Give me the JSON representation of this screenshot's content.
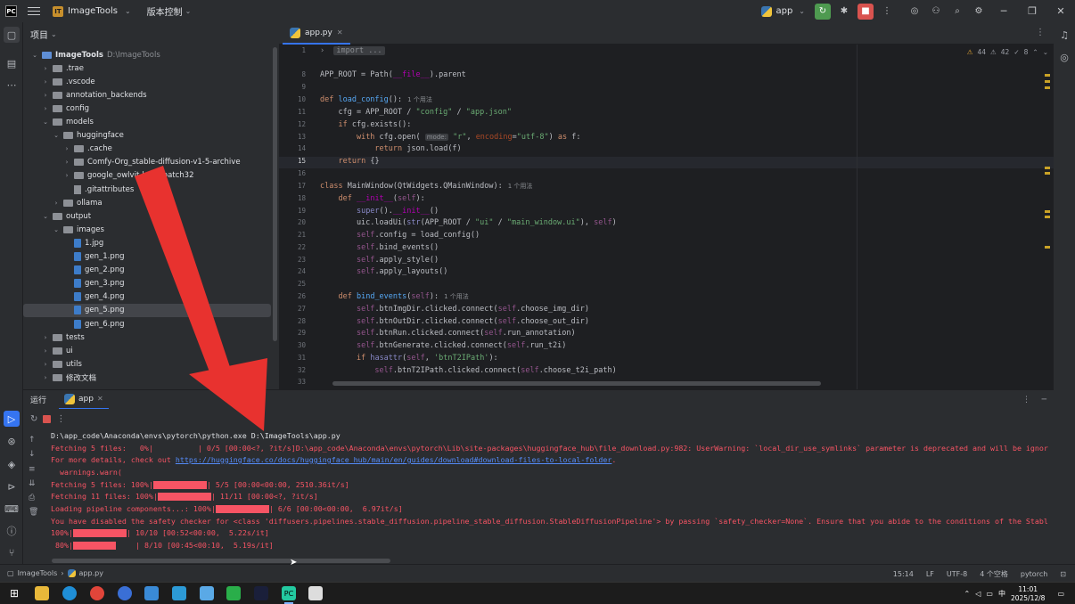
{
  "titlebar": {
    "project_name": "ImageTools",
    "vcs_label": "版本控制",
    "run_config": "app",
    "win_minimize": "─",
    "win_maximize": "❐",
    "win_close": "✕"
  },
  "project_panel": {
    "title": "项目",
    "tree": [
      {
        "label": "ImageTools",
        "suffix": "D:\\ImageTools",
        "depth": 0,
        "kind": "folder",
        "open": true
      },
      {
        "label": ".trae",
        "depth": 1,
        "kind": "folder"
      },
      {
        "label": ".vscode",
        "depth": 1,
        "kind": "folder"
      },
      {
        "label": "annotation_backends",
        "depth": 1,
        "kind": "folder"
      },
      {
        "label": "config",
        "depth": 1,
        "kind": "folder"
      },
      {
        "label": "models",
        "depth": 1,
        "kind": "folder",
        "open": true
      },
      {
        "label": "huggingface",
        "depth": 2,
        "kind": "folder",
        "open": true
      },
      {
        "label": ".cache",
        "depth": 3,
        "kind": "folder"
      },
      {
        "label": "Comfy-Org_stable-diffusion-v1-5-archive",
        "depth": 3,
        "kind": "folder"
      },
      {
        "label": "google_owlvit-base-patch32",
        "depth": 3,
        "kind": "folder"
      },
      {
        "label": ".gitattributes",
        "depth": 3,
        "kind": "file"
      },
      {
        "label": "ollama",
        "depth": 2,
        "kind": "folder"
      },
      {
        "label": "output",
        "depth": 1,
        "kind": "folder",
        "open": true
      },
      {
        "label": "images",
        "depth": 2,
        "kind": "folder",
        "open": true
      },
      {
        "label": "1.jpg",
        "depth": 3,
        "kind": "image"
      },
      {
        "label": "gen_1.png",
        "depth": 3,
        "kind": "image"
      },
      {
        "label": "gen_2.png",
        "depth": 3,
        "kind": "image"
      },
      {
        "label": "gen_3.png",
        "depth": 3,
        "kind": "image"
      },
      {
        "label": "gen_4.png",
        "depth": 3,
        "kind": "image"
      },
      {
        "label": "gen_5.png",
        "depth": 3,
        "kind": "image",
        "selected": true
      },
      {
        "label": "gen_6.png",
        "depth": 3,
        "kind": "image"
      },
      {
        "label": "tests",
        "depth": 1,
        "kind": "folder"
      },
      {
        "label": "ui",
        "depth": 1,
        "kind": "folder"
      },
      {
        "label": "utils",
        "depth": 1,
        "kind": "folder"
      },
      {
        "label": "修改文档",
        "depth": 1,
        "kind": "folder"
      }
    ]
  },
  "editor": {
    "tab_label": "app.py",
    "inspections": {
      "warnings": "44",
      "weak_warnings": "42",
      "typos": "8"
    },
    "line_numbers": [
      "1",
      "7",
      "8",
      "9",
      "10",
      "11",
      "12",
      "13",
      "14",
      "15",
      "16",
      "17",
      "18",
      "19",
      "20",
      "21",
      "22",
      "23",
      "24",
      "25",
      "26",
      "27",
      "28",
      "29",
      "30",
      "31",
      "32",
      "33"
    ],
    "current_line": "15"
  },
  "run_panel": {
    "header_label": "运行",
    "tab_label": "app",
    "console": [
      {
        "color": "w",
        "text": "D:\\app_code\\Anaconda\\envs\\pytorch\\python.exe D:\\ImageTools\\app.py"
      },
      {
        "color": "r",
        "text": "Fetching 5 files:   0%|          | 0/5 [00:00<?, ?it/s]D:\\app_code\\Anaconda\\envs\\pytorch\\Lib\\site-packages\\huggingface_hub\\file_download.py:982: UserWarning: `local_dir_use_symlinks` parameter is deprecated and will be ignor"
      },
      {
        "color": "r",
        "text": "For more details, check out ",
        "link": "https://huggingface.co/docs/huggingface_hub/main/en/guides/download#download-files-to-local-folder",
        "after": "."
      },
      {
        "color": "r",
        "text": "  warnings.warn("
      },
      {
        "color": "r",
        "text": "Fetching 5 files: 100%|",
        "bar": 1.0,
        "after": "| 5/5 [00:00<00:00, 2510.36it/s]"
      },
      {
        "color": "r",
        "text": "Fetching 11 files: 100%|",
        "bar": 1.0,
        "after": "| 11/11 [00:00<?, ?it/s]"
      },
      {
        "color": "r",
        "text": "Loading pipeline components...: 100%|",
        "bar": 1.0,
        "after": "| 6/6 [00:00<00:00,  6.97it/s]"
      },
      {
        "color": "r",
        "text": "You have disabled the safety checker for <class 'diffusers.pipelines.stable_diffusion.pipeline_stable_diffusion.StableDiffusionPipeline'> by passing `safety_checker=None`. Ensure that you abide to the conditions of the Stabl"
      },
      {
        "color": "r",
        "text": "100%|",
        "bar": 1.0,
        "after": "| 10/10 [00:52<00:00,  5.22s/it]"
      },
      {
        "color": "r",
        "text": " 80%|",
        "bar": 0.8,
        "after": "  | 8/10 [00:45<00:10,  5.19s/it]"
      }
    ]
  },
  "statusbar": {
    "crumb_project": "ImageTools",
    "crumb_file": "app.py",
    "position": "15:14",
    "line_sep": "LF",
    "encoding": "UTF-8",
    "indent": "4 个空格",
    "interpreter": "pytorch"
  },
  "taskbar": {
    "time": "11:01",
    "date": "2025/12/8",
    "ime": "中"
  },
  "colors": {
    "accent": "#3574f0",
    "error_red": "#f75464",
    "annotation_arrow": "#e8322f"
  }
}
